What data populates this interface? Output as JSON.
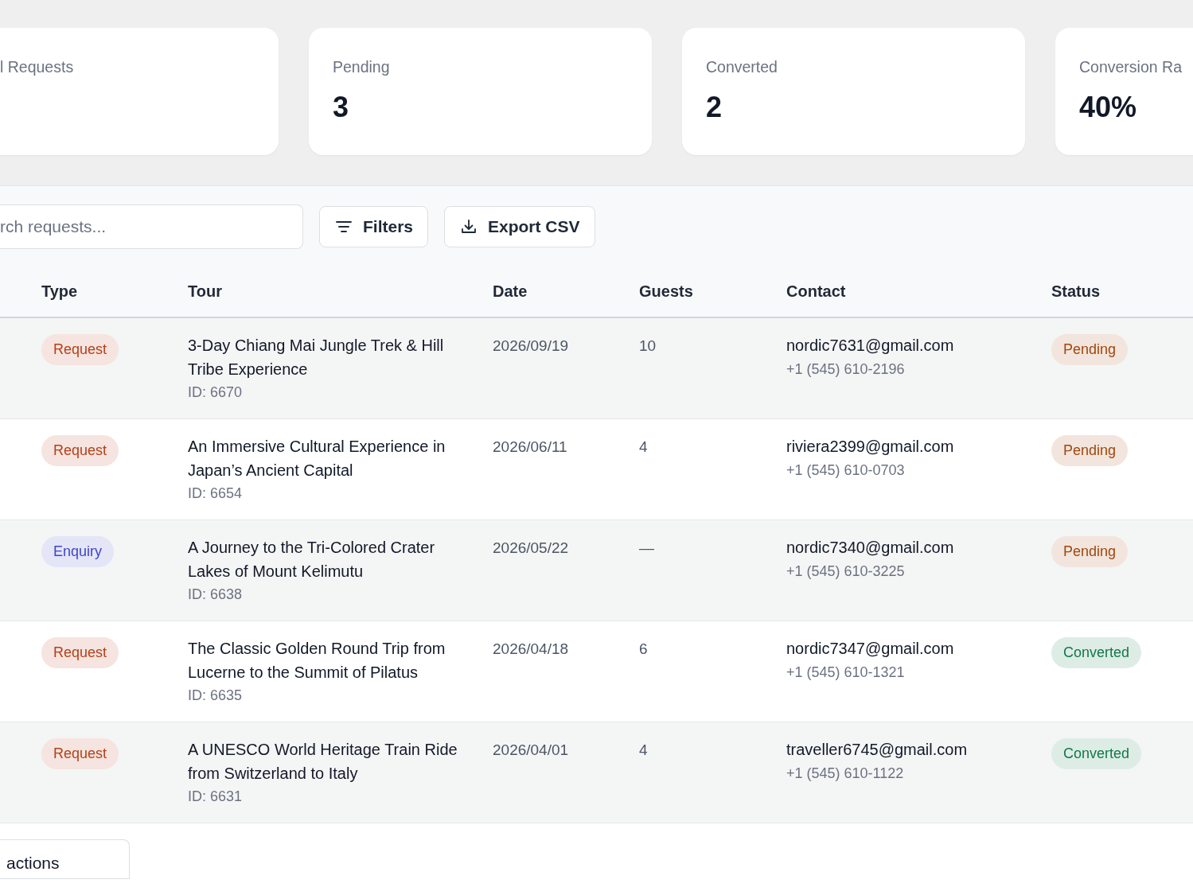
{
  "stats": [
    {
      "label": "l Requests"
    },
    {
      "label": "Pending",
      "value": "3"
    },
    {
      "label": "Converted",
      "value": "2"
    },
    {
      "label": "Conversion Ra",
      "value": "40%"
    }
  ],
  "toolbar": {
    "search": {
      "placeholder": "rch requests..."
    },
    "buttons": [
      {
        "label": "Filters",
        "kind": "filter"
      },
      {
        "label": "Export CSV",
        "kind": "download"
      }
    ]
  },
  "table": {
    "columns": [
      "Type",
      "Tour",
      "Date",
      "Guests",
      "Contact",
      "Status"
    ],
    "rows": [
      {
        "type": {
          "label": "Request",
          "color": "#b5401a"
        },
        "tour": "3-Day Chiang Mai Jungle Trek & Hill Tribe Experience",
        "id": "ID: 6670",
        "date": "2026/09/19",
        "guests": "10",
        "email": "nordic7631@gmail.com",
        "phone": "+1 (545) 610-2196",
        "status": {
          "label": "Pending",
          "color": "#a1470d"
        }
      },
      {
        "type": {
          "label": "Request",
          "color": "#b5401a"
        },
        "tour": "An Immersive Cultural Experience in Japan’s Ancient Capital",
        "id": "ID: 6654",
        "date": "2026/06/11",
        "guests": "4",
        "email": "riviera2399@gmail.com",
        "phone": "+1 (545) 610-0703",
        "status": {
          "label": "Pending",
          "color": "#a1470d"
        }
      },
      {
        "type": {
          "label": "Enquiry",
          "color": "#3f45c8"
        },
        "tour": "A Journey to the Tri-Colored Crater Lakes of Mount Kelimutu",
        "id": "ID: 6638",
        "date": "2026/05/22",
        "guests": "—",
        "email": "nordic7340@gmail.com",
        "phone": "+1 (545) 610-3225",
        "status": {
          "label": "Pending",
          "color": "#a1470d"
        }
      },
      {
        "type": {
          "label": "Request",
          "color": "#b5401a"
        },
        "tour": "The Classic Golden Round Trip from Lucerne to the Summit of Pilatus",
        "id": "ID: 6635",
        "date": "2026/04/18",
        "guests": "6",
        "email": "nordic7347@gmail.com",
        "phone": "+1 (545) 610-1321",
        "status": {
          "label": "Converted",
          "color": "#11784a"
        }
      },
      {
        "type": {
          "label": "Request",
          "color": "#b5401a"
        },
        "tour": "A UNESCO World Heritage Train Ride from Switzerland to Italy",
        "id": "ID: 6631",
        "date": "2026/04/01",
        "guests": "4",
        "email": "traveller6745@gmail.com",
        "phone": "+1 (545) 610-1122",
        "status": {
          "label": "Converted",
          "color": "#11784a"
        }
      }
    ]
  },
  "footer": {
    "bulk_button": "actions"
  }
}
